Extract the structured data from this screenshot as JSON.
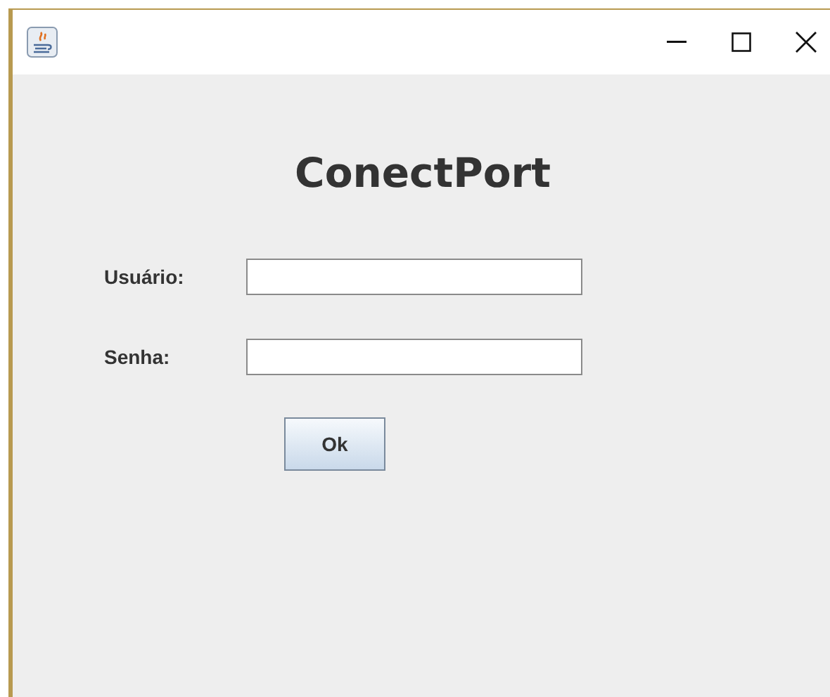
{
  "window": {
    "controls": [
      {
        "kind": "minimize"
      },
      {
        "kind": "maximize"
      },
      {
        "kind": "close"
      }
    ]
  },
  "title": "ConectPort",
  "fields": [
    {
      "label": "Usuário:"
    },
    {
      "label": "Senha:"
    }
  ],
  "button": "Ok"
}
